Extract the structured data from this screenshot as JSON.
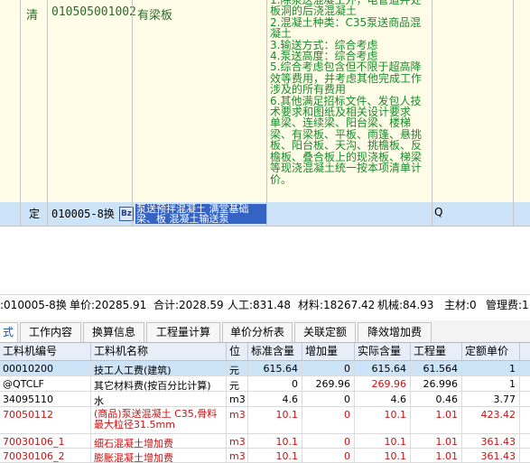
{
  "boq": {
    "item_row": {
      "type": "清",
      "code": "010505001002",
      "name": "有梁板",
      "features": "1.除泵送混凝土外，电管道井处板洞的后浇混凝土\n2.混凝土种类：C35泵送商品混凝土\n3.输送方式：综合考虑\n4.泵送高度：综合考虑\n5.综合考虑包含但不限于超高降效等费用，并考虑其他完成工作涉及的所有费用\n6.其他满足招标文件、发包人技术要求和图纸及相关设计要求\n单梁、连续梁、阳台梁、楼梯梁、有梁板、平板、雨篷、悬挑板、阳台板、天沟、挑檐板、反檐板、叠合板上的现浇板、梯梁等现浇混凝土统一按本项清单计价。"
    },
    "quota_row": {
      "type": "定",
      "code": "010005-8换",
      "icon": "Bz",
      "name": "泵送预拌混凝土 满堂基础 梁、板 混凝土输送泵",
      "unit": "Q"
    }
  },
  "info_bar": {
    "code": ":010005-8换",
    "unit_price": "单价:20285.91",
    "total": "合计:2028.59",
    "labor": "人工:831.48",
    "material": "材料:18267.42",
    "machine": "机械:84.93",
    "main_material": "主材:0",
    "mgmt": "管理费:1"
  },
  "tabs": [
    {
      "label": "式"
    },
    {
      "label": "工作内容"
    },
    {
      "label": "换算信息"
    },
    {
      "label": "工程量计算"
    },
    {
      "label": "单价分析表"
    },
    {
      "label": "关联定额"
    },
    {
      "label": "降效增加费"
    }
  ],
  "table": {
    "headers": [
      "工料机编号",
      "工料机名称",
      "位",
      "标准含量",
      "增加量",
      "实际含量",
      "工程量",
      "定额单价"
    ],
    "rows": [
      {
        "code": "00010200",
        "name": "技工人工费(建筑)",
        "unit": "元",
        "std": "615.64",
        "add": "0",
        "actual": "615.64",
        "qty": "61.564",
        "price": "1",
        "red": false
      },
      {
        "code": "@QTCLF",
        "name": "其它材料费(按百分比计算)",
        "unit": "元",
        "std": "0",
        "add": "269.96",
        "actual": "269.96",
        "qty": "26.996",
        "price": "1",
        "red": false
      },
      {
        "code": "34095110",
        "name": "水",
        "unit": "m3",
        "std": "4.6",
        "add": "0",
        "actual": "4.6",
        "qty": "0.46",
        "price": "3.77",
        "red": false
      },
      {
        "code": "70050112",
        "name": "(商品)泵送混凝土 C35,骨料最大粒径31.5mm",
        "unit": "m3",
        "std": "10.1",
        "add": "0",
        "actual": "10.1",
        "qty": "1.01",
        "price": "423.42",
        "red": true
      },
      {
        "code": "70030106_1",
        "name": "细石混凝土增加费",
        "unit": "m3",
        "std": "10.1",
        "add": "0",
        "actual": "10.1",
        "qty": "1.01",
        "price": "361.43",
        "red": true
      },
      {
        "code": "70030106_2",
        "name": "膨胀混凝土增加费",
        "unit": "m3",
        "std": "10.1",
        "add": "0",
        "actual": "10.1",
        "qty": "1.01",
        "price": "361.43",
        "red": true
      }
    ]
  },
  "colors": {
    "item_bg": "#fffde8",
    "selected_bg": "#cde4f8",
    "feature_text": "#1a8a2a",
    "red_text": "#cc1111"
  }
}
